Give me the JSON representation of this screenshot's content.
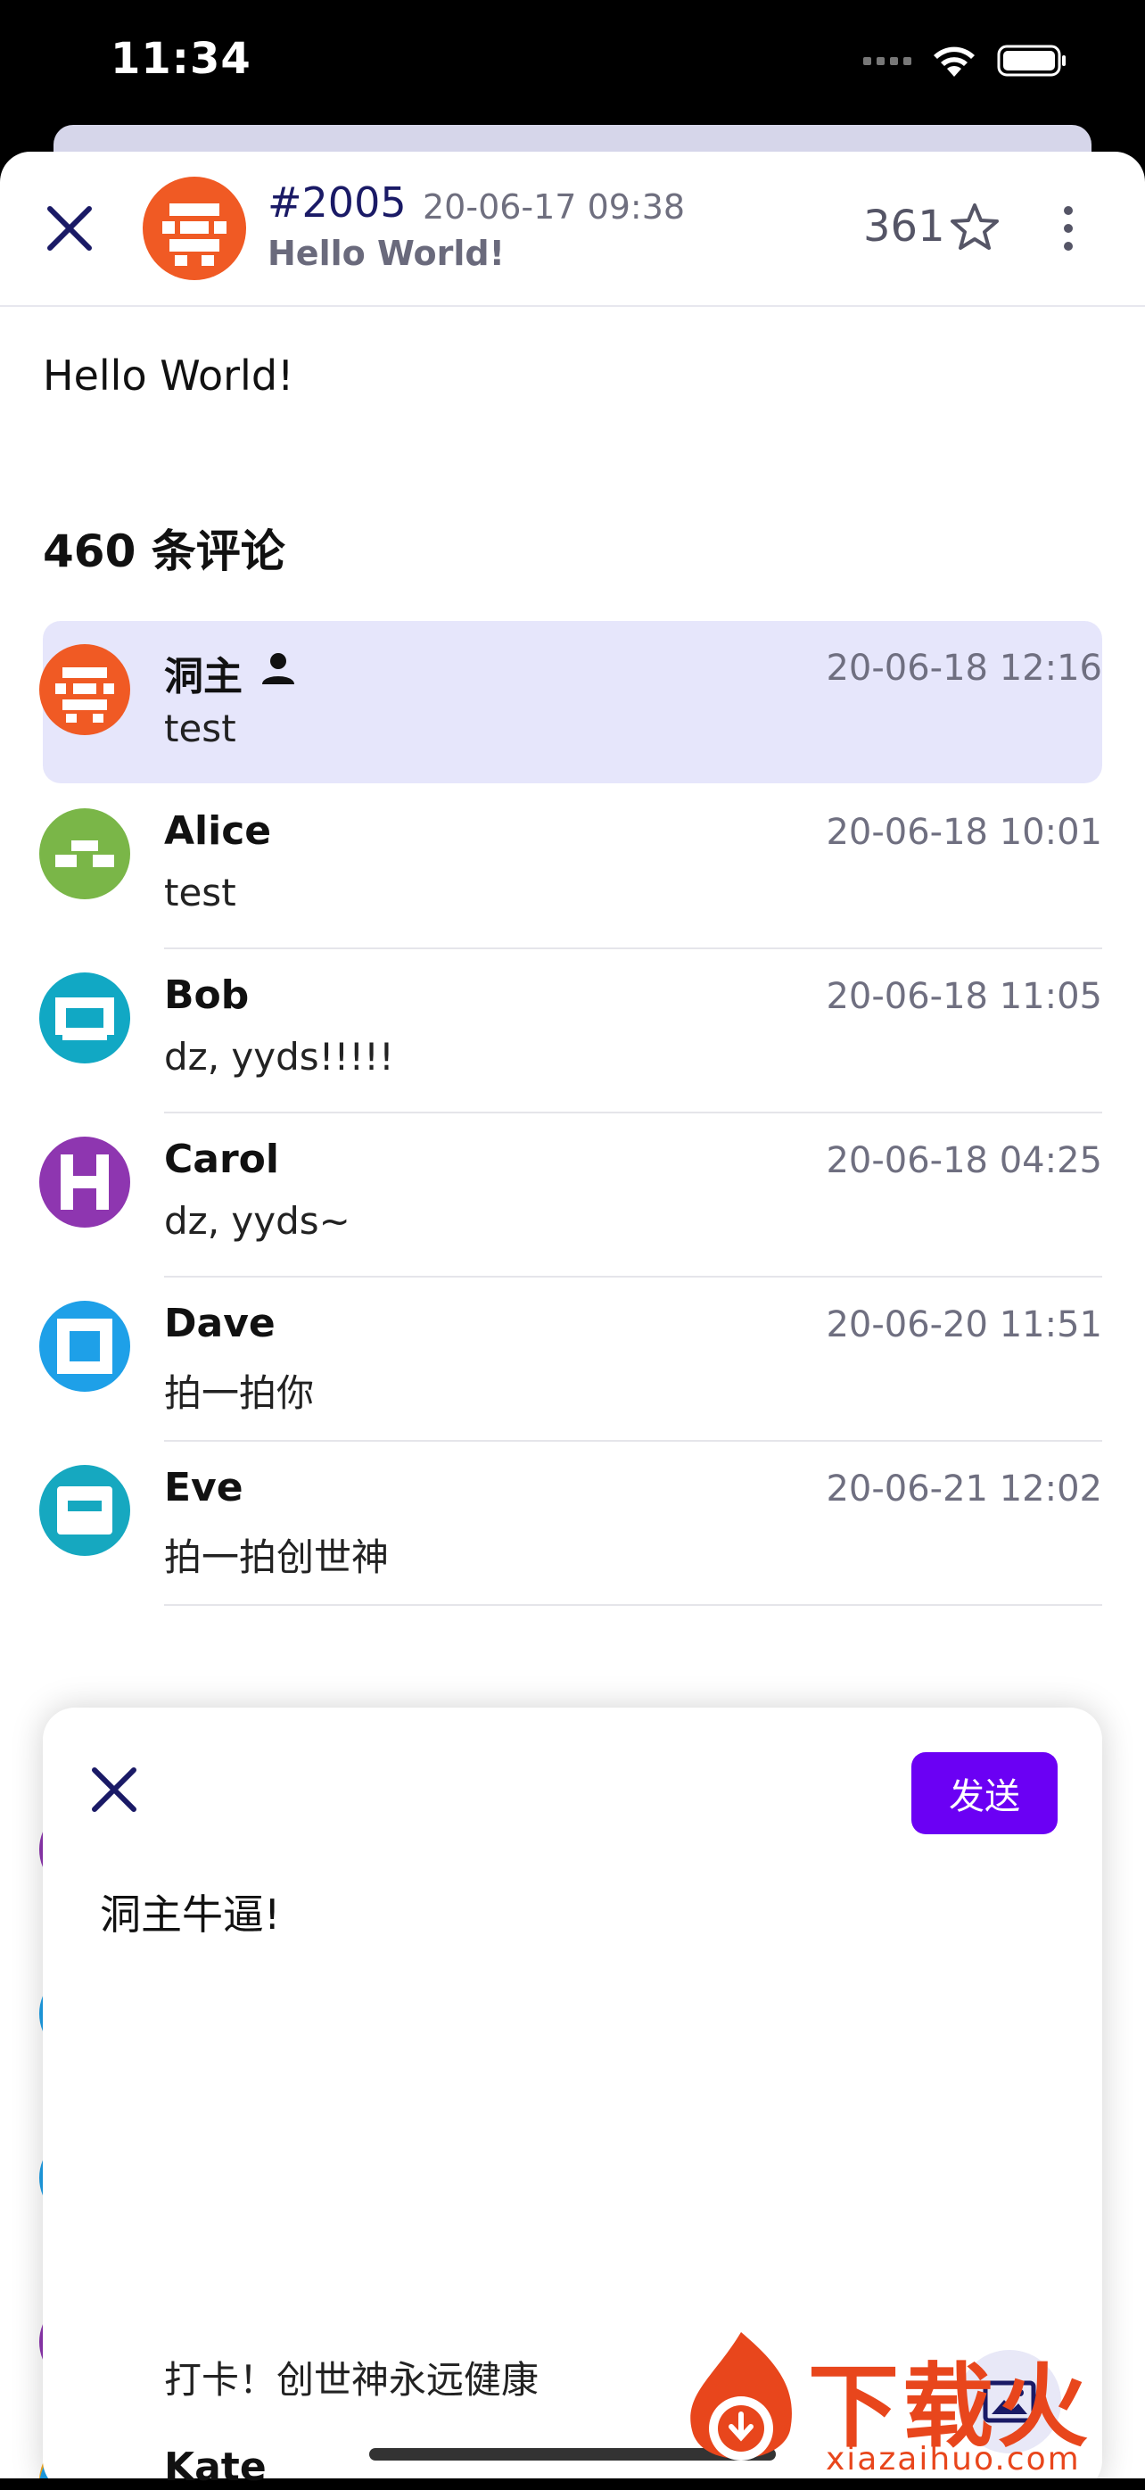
{
  "status_bar": {
    "time": "11:34"
  },
  "post": {
    "id": "#2005",
    "date": "20-06-17 09:38",
    "subtitle": "Hello World!",
    "star_count": "361",
    "body": "Hello World!",
    "comment_count": "460 条评论",
    "avatar_color": "#f05a24"
  },
  "comments": [
    {
      "name": "洞主",
      "time": "20-06-18 12:16",
      "text": "test",
      "color": "#f05a24",
      "highlighted": true,
      "is_op": true
    },
    {
      "name": "Alice",
      "time": "20-06-18 10:01",
      "text": "test",
      "color": "#7ab648"
    },
    {
      "name": "Bob",
      "time": "20-06-18 11:05",
      "text": "dz, yyds!!!!!",
      "color": "#11a8c4"
    },
    {
      "name": "Carol",
      "time": "20-06-18 04:25",
      "text": "dz, yyds~",
      "color": "#8e36b0"
    },
    {
      "name": "Dave",
      "time": "20-06-20 11:51",
      "text": "拍一拍你",
      "color": "#1ea0e8"
    },
    {
      "name": "Eve",
      "time": "20-06-21 12:02",
      "text": "拍一拍创世神",
      "color": "#16a8c0"
    }
  ],
  "compose": {
    "send_label": "发送",
    "text": "洞主牛逼!"
  },
  "background_peek": {
    "text": "打卡！创世神永远健康",
    "name": "Kate"
  },
  "watermark": {
    "text": "下载火",
    "url": "xiazaihuo.com"
  }
}
